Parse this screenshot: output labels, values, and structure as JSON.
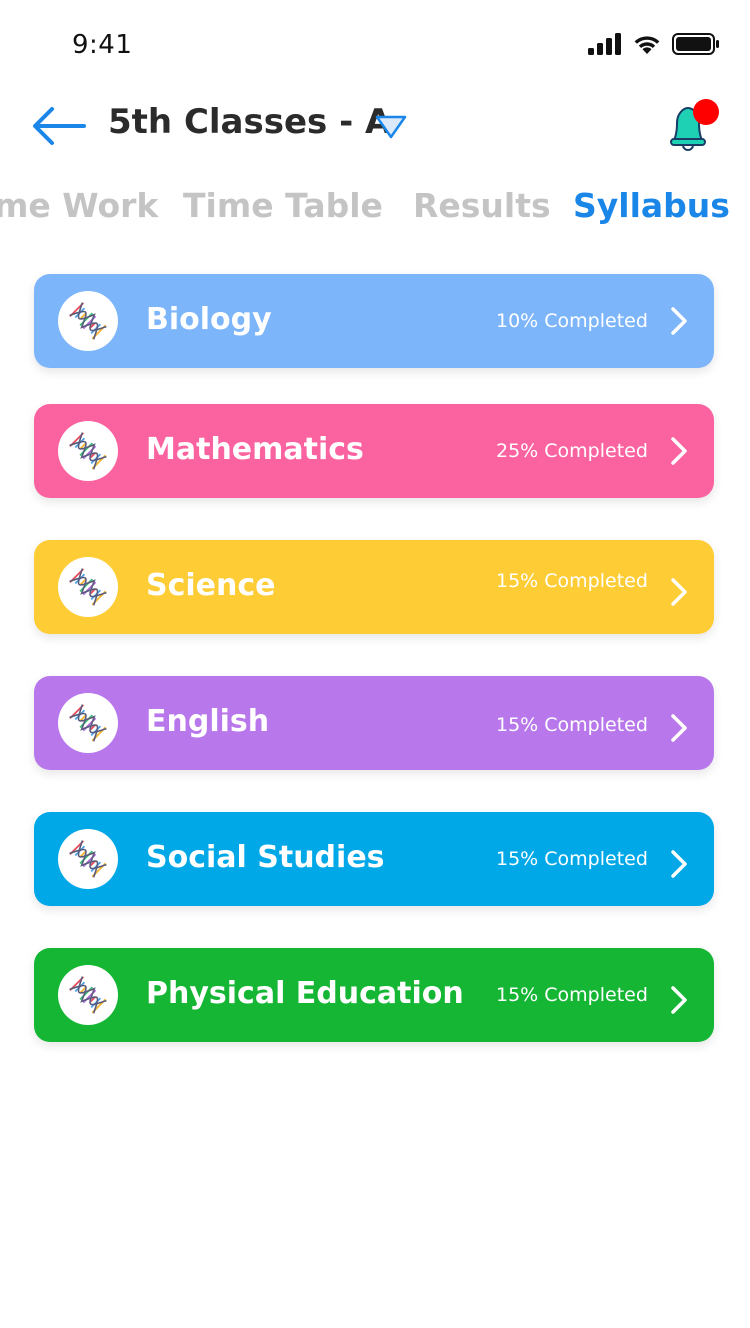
{
  "status_bar": {
    "time": "9:41"
  },
  "header": {
    "title": "5th Classes - A"
  },
  "tabs": [
    {
      "label": "me Work",
      "active": false
    },
    {
      "label": "Time Table",
      "active": false
    },
    {
      "label": "Results",
      "active": false
    },
    {
      "label": "Syllabus",
      "active": true
    }
  ],
  "subjects": [
    {
      "name": "Biology",
      "progress_text": "10% Completed",
      "progress_percent": 10,
      "color": "#7db5fb"
    },
    {
      "name": "Mathematics",
      "progress_text": "25% Completed",
      "progress_percent": 25,
      "color": "#fb62a0"
    },
    {
      "name": "Science",
      "progress_text": "15% Completed",
      "progress_percent": 15,
      "color": "#fecc35"
    },
    {
      "name": "English",
      "progress_text": "15% Completed",
      "progress_percent": 15,
      "color": "#b878eb"
    },
    {
      "name": "Social Studies",
      "progress_text": "15% Completed",
      "progress_percent": 15,
      "color": "#00a8e8"
    },
    {
      "name": "Physical Education",
      "progress_text": "15% Completed",
      "progress_percent": 15,
      "color": "#14b634"
    }
  ],
  "icons": {
    "back": "back-arrow-icon",
    "dropdown": "triangle-down-icon",
    "notifications": "bell-icon",
    "subject": "dna-icon",
    "chevron": "chevron-right-icon"
  },
  "colors": {
    "accent": "#1a87e8",
    "inactive_tab": "#c4c4c4",
    "notification_dot": "#ff0000",
    "bell": "#1ed1b5"
  }
}
